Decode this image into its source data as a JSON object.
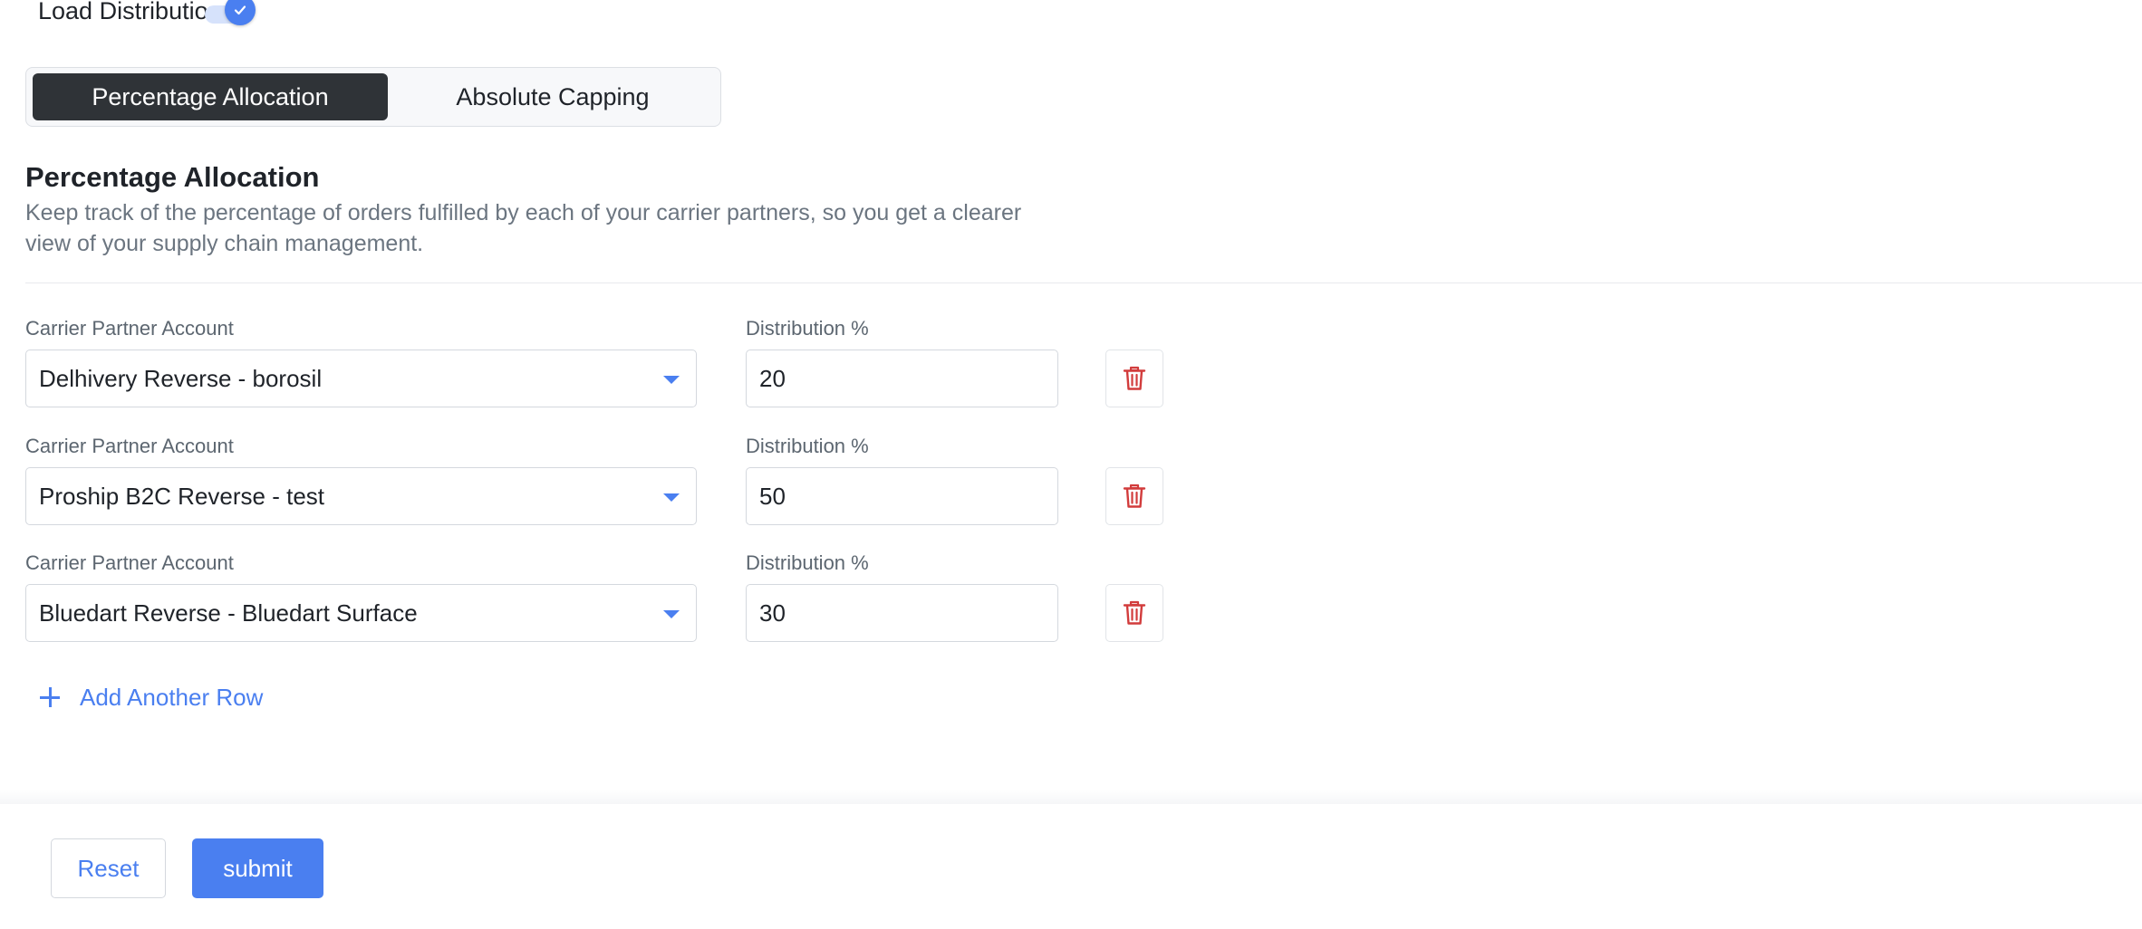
{
  "load_distribution": {
    "label": "Load Distribution",
    "enabled": true
  },
  "tabs": [
    {
      "label": "Percentage Allocation",
      "active": true
    },
    {
      "label": "Absolute Capping",
      "active": false
    }
  ],
  "section": {
    "title": "Percentage Allocation",
    "description": "Keep track of the percentage of orders fulfilled by each of your carrier partners, so you get a clearer view of your supply chain management."
  },
  "rows": [
    {
      "carrier_label": "Carrier Partner Account",
      "carrier_value": "Delhivery Reverse - borosil",
      "distribution_label": "Distribution %",
      "distribution_value": "20"
    },
    {
      "carrier_label": "Carrier Partner Account",
      "carrier_value": "Proship B2C Reverse - test",
      "distribution_label": "Distribution %",
      "distribution_value": "50"
    },
    {
      "carrier_label": "Carrier Partner Account",
      "carrier_value": "Bluedart Reverse - Bluedart Surface",
      "distribution_label": "Distribution %",
      "distribution_value": "30"
    }
  ],
  "add_row_label": "Add Another Row",
  "footer": {
    "reset_label": "Reset",
    "submit_label": "submit"
  },
  "colors": {
    "accent": "#4a7ff0",
    "danger": "#d23c3c",
    "active_tab": "#2f3337"
  },
  "icons": {
    "toggle": "check-icon",
    "caret": "caret-down-icon",
    "delete": "trash-icon",
    "add": "plus-icon"
  }
}
